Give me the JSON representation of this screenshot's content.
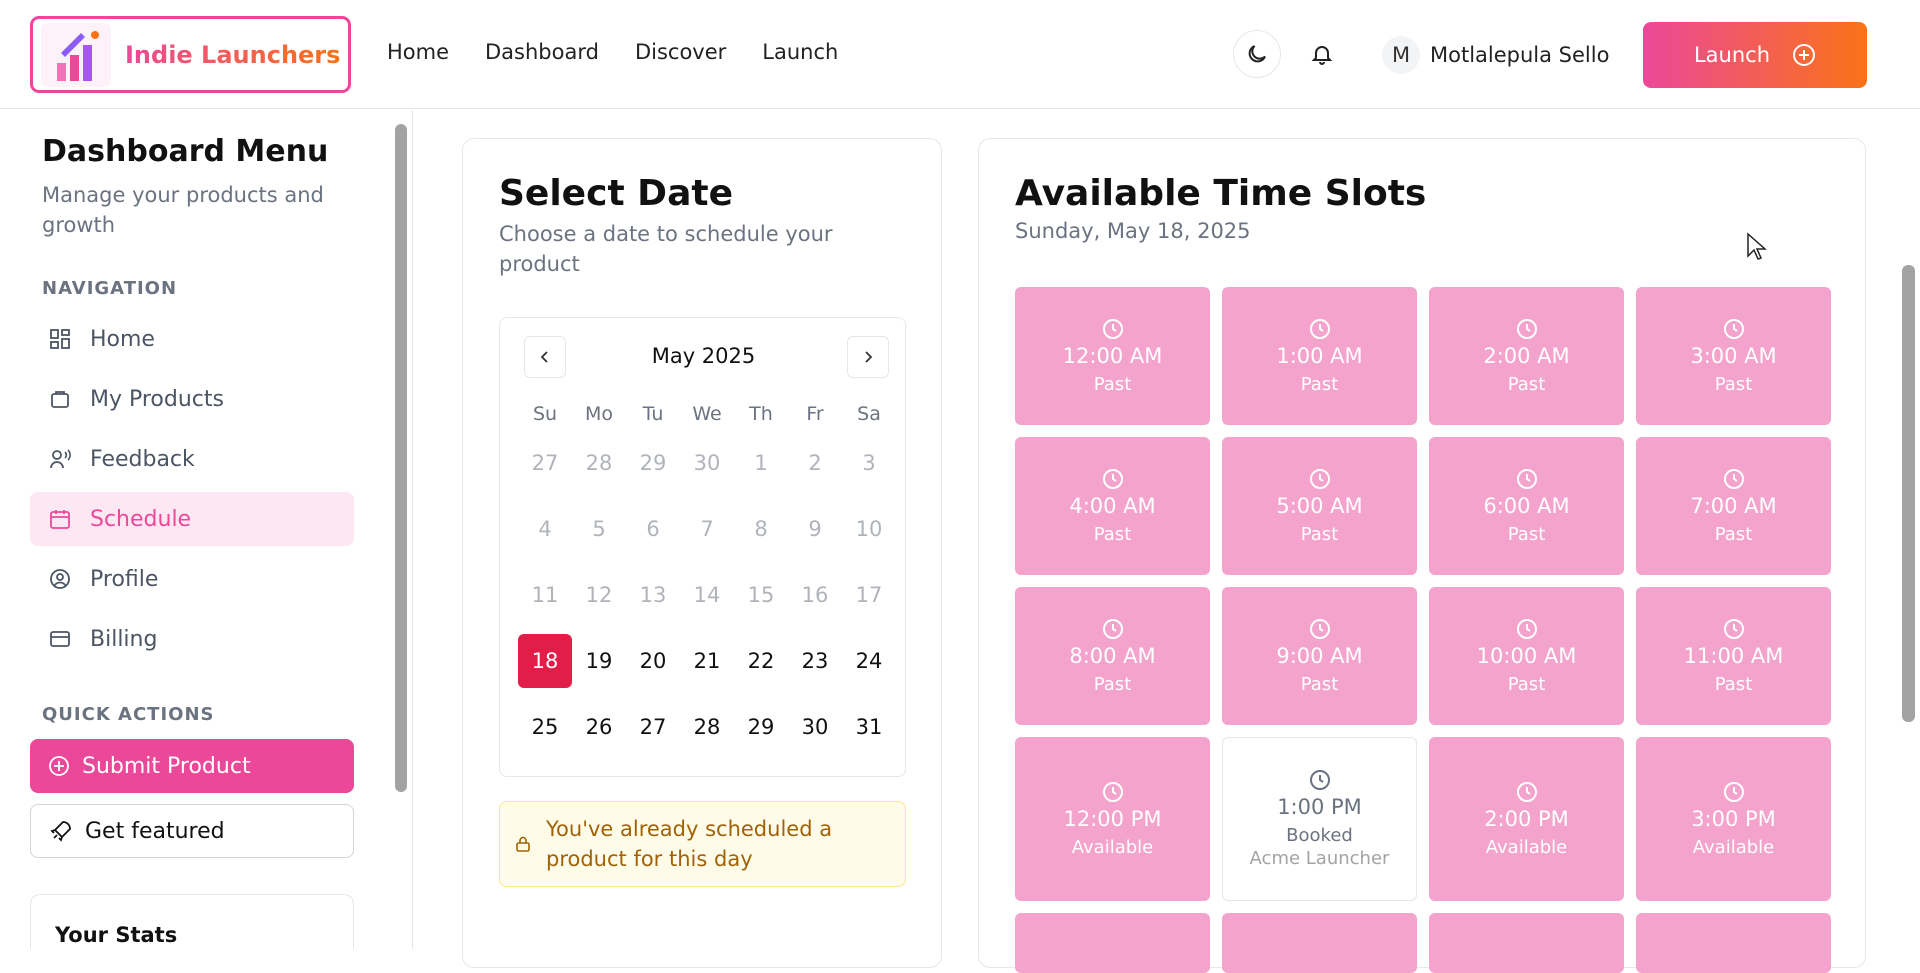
{
  "header": {
    "brand": "Indie Launchers",
    "nav": [
      "Home",
      "Dashboard",
      "Discover",
      "Launch"
    ],
    "user_initial": "M",
    "user_name": "Motlalepula Sello",
    "launch_label": "Launch"
  },
  "sidebar": {
    "title": "Dashboard Menu",
    "subtitle": "Manage your products and growth",
    "navigation_label": "NAVIGATION",
    "items": [
      {
        "label": "Home",
        "icon": "grid-icon"
      },
      {
        "label": "My Products",
        "icon": "package-icon"
      },
      {
        "label": "Feedback",
        "icon": "user-voice-icon"
      },
      {
        "label": "Schedule",
        "icon": "calendar-icon",
        "active": true
      },
      {
        "label": "Profile",
        "icon": "user-circle-icon"
      },
      {
        "label": "Billing",
        "icon": "credit-card-icon"
      }
    ],
    "quick_actions_label": "QUICK ACTIONS",
    "submit_label": "Submit Product",
    "featured_label": "Get featured",
    "stats_title": "Your Stats"
  },
  "date_card": {
    "title": "Select Date",
    "subtitle": "Choose a date to schedule your product",
    "month": "May 2025",
    "weekdays": [
      "Su",
      "Mo",
      "Tu",
      "We",
      "Th",
      "Fr",
      "Sa"
    ],
    "weeks": [
      [
        "27",
        "28",
        "29",
        "30",
        "1",
        "2",
        "3"
      ],
      [
        "4",
        "5",
        "6",
        "7",
        "8",
        "9",
        "10"
      ],
      [
        "11",
        "12",
        "13",
        "14",
        "15",
        "16",
        "17"
      ],
      [
        "18",
        "19",
        "20",
        "21",
        "22",
        "23",
        "24"
      ],
      [
        "25",
        "26",
        "27",
        "28",
        "29",
        "30",
        "31"
      ]
    ],
    "selected_day": "18",
    "notice": "You've already scheduled a product for this day"
  },
  "slots_card": {
    "title": "Available Time Slots",
    "date": "Sunday, May 18, 2025",
    "slots": [
      {
        "time": "12:00 AM",
        "status": "Past"
      },
      {
        "time": "1:00 AM",
        "status": "Past"
      },
      {
        "time": "2:00 AM",
        "status": "Past"
      },
      {
        "time": "3:00 AM",
        "status": "Past"
      },
      {
        "time": "4:00 AM",
        "status": "Past"
      },
      {
        "time": "5:00 AM",
        "status": "Past"
      },
      {
        "time": "6:00 AM",
        "status": "Past"
      },
      {
        "time": "7:00 AM",
        "status": "Past"
      },
      {
        "time": "8:00 AM",
        "status": "Past"
      },
      {
        "time": "9:00 AM",
        "status": "Past"
      },
      {
        "time": "10:00 AM",
        "status": "Past"
      },
      {
        "time": "11:00 AM",
        "status": "Past"
      },
      {
        "time": "12:00 PM",
        "status": "Available"
      },
      {
        "time": "1:00 PM",
        "status": "Booked",
        "booked_by": "Acme Launcher"
      },
      {
        "time": "2:00 PM",
        "status": "Available"
      },
      {
        "time": "3:00 PM",
        "status": "Available"
      }
    ]
  },
  "colors": {
    "accent": "#ec4899",
    "accent2": "#f97316",
    "slot": "#f4a3cc",
    "selected": "#e11d48"
  }
}
